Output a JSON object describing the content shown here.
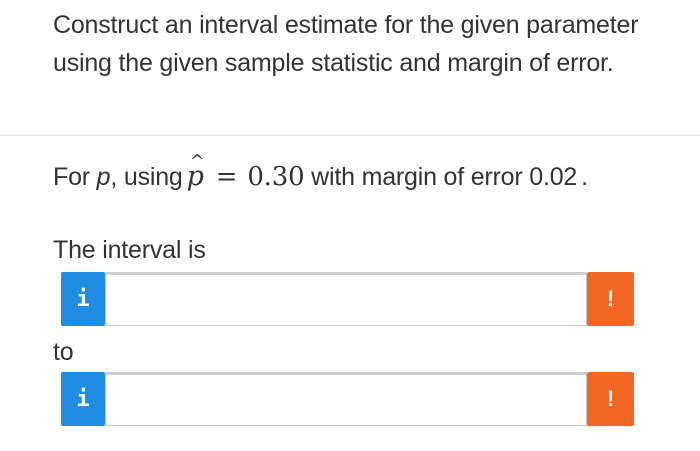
{
  "question": {
    "text": "Construct an interval estimate for the given parameter using the given sample statistic and margin of error."
  },
  "prompt": {
    "lead_text": "For ",
    "parameter": "p",
    "using_text": ", using",
    "statistic_symbol": "p",
    "hat_symbol": "^",
    "equals": "=",
    "statistic_value": "0.30",
    "margin_text": " with margin of error 0.02",
    "end_period": "."
  },
  "interval_label": "The interval is",
  "to_label": "to",
  "fields": [
    {
      "info_icon_glyph": "i",
      "value": "",
      "placeholder": "",
      "status_icon_glyph": "!"
    },
    {
      "info_icon_glyph": "i",
      "value": "",
      "placeholder": "",
      "status_icon_glyph": "!"
    }
  ],
  "colors": {
    "info_blue": "#1f8de1",
    "warning_orange": "#f26522",
    "text": "#333333"
  }
}
